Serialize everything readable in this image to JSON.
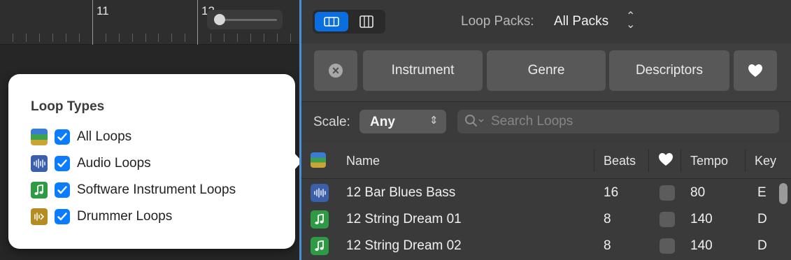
{
  "ruler": {
    "bar_11": "11",
    "bar_12": "12"
  },
  "loop_types": {
    "title": "Loop Types",
    "items": [
      {
        "label": "All Loops",
        "checked": true,
        "icon": "all-loops-icon"
      },
      {
        "label": "Audio Loops",
        "checked": true,
        "icon": "audio-loop-icon"
      },
      {
        "label": "Software Instrument Loops",
        "checked": true,
        "icon": "software-instrument-icon"
      },
      {
        "label": "Drummer Loops",
        "checked": true,
        "icon": "drummer-loop-icon"
      }
    ]
  },
  "browser": {
    "loop_packs_label": "Loop Packs:",
    "loop_packs_value": "All Packs",
    "filters": [
      "Instrument",
      "Genre",
      "Descriptors"
    ],
    "scale_label": "Scale:",
    "scale_value": "Any",
    "search_placeholder": "Search Loops",
    "columns": {
      "name": "Name",
      "beats": "Beats",
      "tempo": "Tempo",
      "key": "Key"
    },
    "rows": [
      {
        "type": "audio",
        "name": "12 Bar Blues Bass",
        "beats": "16",
        "tempo": "80",
        "key": "E"
      },
      {
        "type": "software",
        "name": "12 String Dream 01",
        "beats": "8",
        "tempo": "140",
        "key": "D"
      },
      {
        "type": "software",
        "name": "12 String Dream 02",
        "beats": "8",
        "tempo": "140",
        "key": "D"
      }
    ]
  },
  "colors": {
    "accent": "#0a7cff",
    "audio_icon": "#3b5fa8",
    "software_icon": "#2f9a44",
    "drummer_icon": "#b58c22"
  }
}
